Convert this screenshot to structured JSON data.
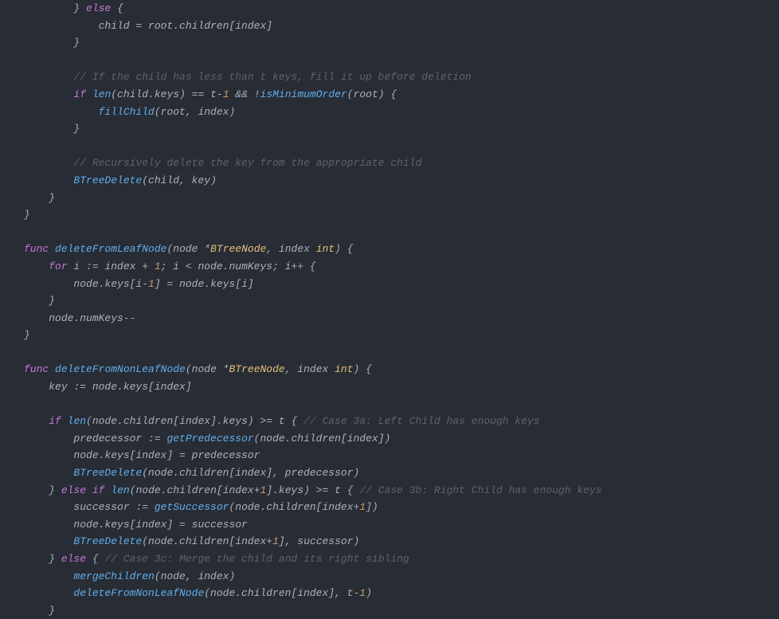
{
  "code": {
    "lines": [
      {
        "indent": 8,
        "tokens": [
          {
            "t": "}",
            "c": "op"
          },
          {
            "t": " ",
            "c": "op"
          },
          {
            "t": "else",
            "c": "kw"
          },
          {
            "t": " {",
            "c": "op"
          }
        ]
      },
      {
        "indent": 12,
        "tokens": [
          {
            "t": "child = root.children[index]",
            "c": "id"
          }
        ]
      },
      {
        "indent": 8,
        "tokens": [
          {
            "t": "}",
            "c": "op"
          }
        ]
      },
      {
        "indent": 0,
        "tokens": []
      },
      {
        "indent": 8,
        "tokens": [
          {
            "t": "// If the child has less than t keys, fill it up before deletion",
            "c": "cmt"
          }
        ]
      },
      {
        "indent": 8,
        "tokens": [
          {
            "t": "if",
            "c": "kw"
          },
          {
            "t": " ",
            "c": "op"
          },
          {
            "t": "len",
            "c": "fn"
          },
          {
            "t": "(child.keys) == t-",
            "c": "id"
          },
          {
            "t": "1",
            "c": "num"
          },
          {
            "t": " && !",
            "c": "id"
          },
          {
            "t": "isMinimumOrder",
            "c": "fn"
          },
          {
            "t": "(root) {",
            "c": "id"
          }
        ]
      },
      {
        "indent": 12,
        "tokens": [
          {
            "t": "fillChild",
            "c": "fn"
          },
          {
            "t": "(root, index)",
            "c": "id"
          }
        ]
      },
      {
        "indent": 8,
        "tokens": [
          {
            "t": "}",
            "c": "op"
          }
        ]
      },
      {
        "indent": 0,
        "tokens": []
      },
      {
        "indent": 8,
        "tokens": [
          {
            "t": "// Recursively delete the key from the appropriate child",
            "c": "cmt"
          }
        ]
      },
      {
        "indent": 8,
        "tokens": [
          {
            "t": "BTreeDelete",
            "c": "fn"
          },
          {
            "t": "(child, key)",
            "c": "id"
          }
        ]
      },
      {
        "indent": 4,
        "tokens": [
          {
            "t": "}",
            "c": "op"
          }
        ]
      },
      {
        "indent": 0,
        "tokens": [
          {
            "t": "}",
            "c": "op"
          }
        ]
      },
      {
        "indent": 0,
        "tokens": []
      },
      {
        "indent": 0,
        "tokens": [
          {
            "t": "func",
            "c": "kw"
          },
          {
            "t": " ",
            "c": "op"
          },
          {
            "t": "deleteFromLeafNode",
            "c": "fn"
          },
          {
            "t": "(",
            "c": "paren"
          },
          {
            "t": "node *",
            "c": "id"
          },
          {
            "t": "BTreeNode",
            "c": "type"
          },
          {
            "t": ", index ",
            "c": "id"
          },
          {
            "t": "int",
            "c": "type"
          },
          {
            "t": ")",
            "c": "paren"
          },
          {
            "t": " {",
            "c": "op"
          }
        ]
      },
      {
        "indent": 4,
        "tokens": [
          {
            "t": "for",
            "c": "kw"
          },
          {
            "t": " i := index + ",
            "c": "id"
          },
          {
            "t": "1",
            "c": "num"
          },
          {
            "t": "; i < node.numKeys; i++ {",
            "c": "id"
          }
        ]
      },
      {
        "indent": 8,
        "tokens": [
          {
            "t": "node.keys[i-",
            "c": "id"
          },
          {
            "t": "1",
            "c": "num"
          },
          {
            "t": "] = node.keys[i]",
            "c": "id"
          }
        ]
      },
      {
        "indent": 4,
        "tokens": [
          {
            "t": "}",
            "c": "op"
          }
        ]
      },
      {
        "indent": 4,
        "tokens": [
          {
            "t": "node.numKeys--",
            "c": "id"
          }
        ]
      },
      {
        "indent": 0,
        "tokens": [
          {
            "t": "}",
            "c": "op"
          }
        ]
      },
      {
        "indent": 0,
        "tokens": []
      },
      {
        "indent": 0,
        "tokens": [
          {
            "t": "func",
            "c": "kw"
          },
          {
            "t": " ",
            "c": "op"
          },
          {
            "t": "deleteFromNonLeafNode",
            "c": "fn"
          },
          {
            "t": "(",
            "c": "paren"
          },
          {
            "t": "node *",
            "c": "id"
          },
          {
            "t": "BTreeNode",
            "c": "type"
          },
          {
            "t": ", index ",
            "c": "id"
          },
          {
            "t": "int",
            "c": "type"
          },
          {
            "t": ")",
            "c": "paren"
          },
          {
            "t": " {",
            "c": "op"
          }
        ]
      },
      {
        "indent": 4,
        "tokens": [
          {
            "t": "key := node.keys[index]",
            "c": "id"
          }
        ]
      },
      {
        "indent": 0,
        "tokens": []
      },
      {
        "indent": 4,
        "tokens": [
          {
            "t": "if",
            "c": "kw"
          },
          {
            "t": " ",
            "c": "op"
          },
          {
            "t": "len",
            "c": "fn"
          },
          {
            "t": "(node.children[index].keys) >= t { ",
            "c": "id"
          },
          {
            "t": "// Case 3a: Left Child has enough keys",
            "c": "cmt"
          }
        ]
      },
      {
        "indent": 8,
        "tokens": [
          {
            "t": "predecessor := ",
            "c": "id"
          },
          {
            "t": "getPredecessor",
            "c": "fn"
          },
          {
            "t": "(node.children[index])",
            "c": "id"
          }
        ]
      },
      {
        "indent": 8,
        "tokens": [
          {
            "t": "node.keys[index] = predecessor",
            "c": "id"
          }
        ]
      },
      {
        "indent": 8,
        "tokens": [
          {
            "t": "BTreeDelete",
            "c": "fn"
          },
          {
            "t": "(node.children[index], predecessor)",
            "c": "id"
          }
        ]
      },
      {
        "indent": 4,
        "tokens": [
          {
            "t": "} ",
            "c": "op"
          },
          {
            "t": "else",
            "c": "kw"
          },
          {
            "t": " ",
            "c": "op"
          },
          {
            "t": "if",
            "c": "kw"
          },
          {
            "t": " ",
            "c": "op"
          },
          {
            "t": "len",
            "c": "fn"
          },
          {
            "t": "(node.children[index+",
            "c": "id"
          },
          {
            "t": "1",
            "c": "num"
          },
          {
            "t": "].keys) >= t { ",
            "c": "id"
          },
          {
            "t": "// Case 3b: Right Child has enough keys",
            "c": "cmt"
          }
        ]
      },
      {
        "indent": 8,
        "tokens": [
          {
            "t": "successor := ",
            "c": "id"
          },
          {
            "t": "getSuccessor",
            "c": "fn"
          },
          {
            "t": "(node.children[index+",
            "c": "id"
          },
          {
            "t": "1",
            "c": "num"
          },
          {
            "t": "])",
            "c": "id"
          }
        ]
      },
      {
        "indent": 8,
        "tokens": [
          {
            "t": "node.keys[index] = successor",
            "c": "id"
          }
        ]
      },
      {
        "indent": 8,
        "tokens": [
          {
            "t": "BTreeDelete",
            "c": "fn"
          },
          {
            "t": "(node.children[index+",
            "c": "id"
          },
          {
            "t": "1",
            "c": "num"
          },
          {
            "t": "], successor)",
            "c": "id"
          }
        ]
      },
      {
        "indent": 4,
        "tokens": [
          {
            "t": "} ",
            "c": "op"
          },
          {
            "t": "else",
            "c": "kw"
          },
          {
            "t": " { ",
            "c": "op"
          },
          {
            "t": "// Case 3c: Merge the child and its right sibling",
            "c": "cmt"
          }
        ]
      },
      {
        "indent": 8,
        "tokens": [
          {
            "t": "mergeChildren",
            "c": "fn"
          },
          {
            "t": "(node, index)",
            "c": "id"
          }
        ]
      },
      {
        "indent": 8,
        "tokens": [
          {
            "t": "deleteFromNonLeafNode",
            "c": "fn"
          },
          {
            "t": "(node.children[index], t-",
            "c": "id"
          },
          {
            "t": "1",
            "c": "num"
          },
          {
            "t": ")",
            "c": "id"
          }
        ]
      },
      {
        "indent": 4,
        "tokens": [
          {
            "t": "}",
            "c": "op"
          }
        ]
      }
    ]
  }
}
